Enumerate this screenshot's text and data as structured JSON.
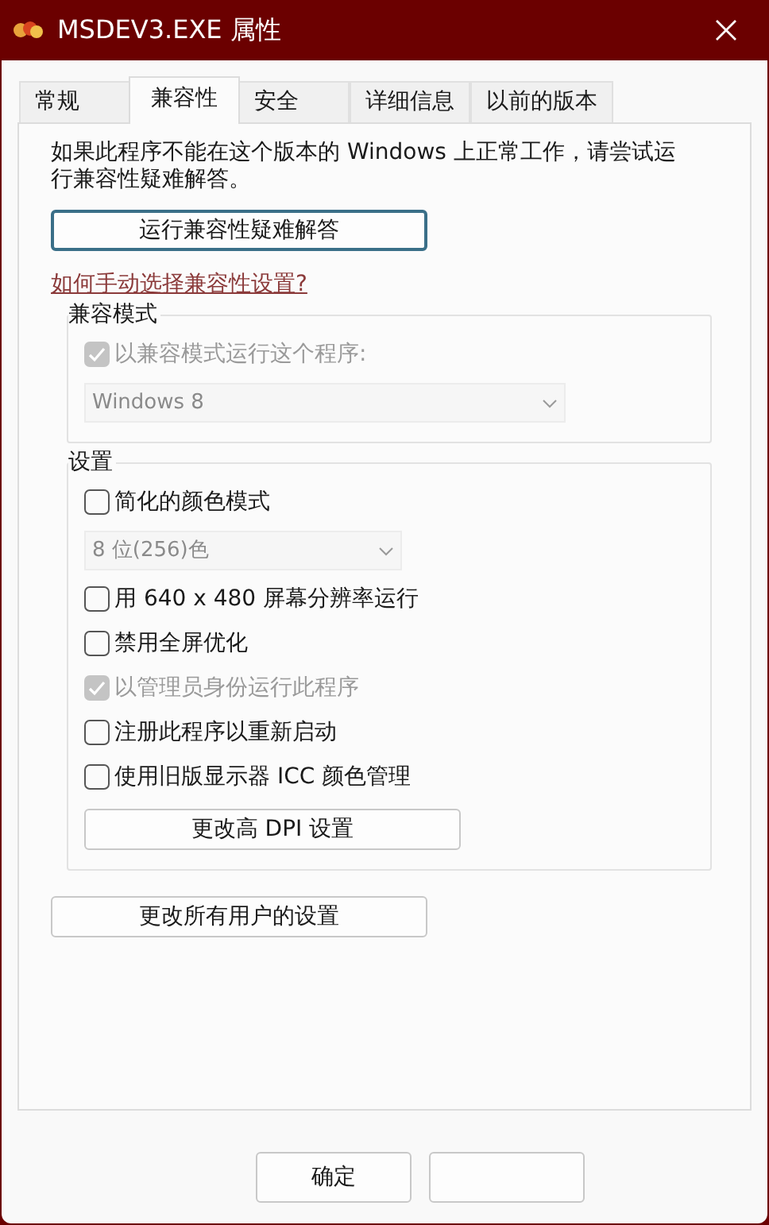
{
  "window": {
    "title": "MSDEV3.EXE 属性"
  },
  "tabs": [
    {
      "label": "常规",
      "selected": false
    },
    {
      "label": "兼容性",
      "selected": true
    },
    {
      "label": "安全",
      "selected": false
    },
    {
      "label": "详细信息",
      "selected": false
    },
    {
      "label": "以前的版本",
      "selected": false
    }
  ],
  "intro": "如果此程序不能在这个版本的 Windows 上正常工作，请尝试运行兼容性疑难解答。",
  "troubleshoot_button": "运行兼容性疑难解答",
  "help_link": "如何手动选择兼容性设置?",
  "compat_mode": {
    "title": "兼容模式",
    "items": [
      {
        "kind": "checkbox",
        "label": "以兼容模式运行这个程序:",
        "checked": true,
        "disabled": true
      },
      {
        "kind": "dropdown",
        "value": "Windows 8",
        "disabled": true
      }
    ]
  },
  "settings": {
    "title": "设置",
    "items": [
      {
        "kind": "checkbox",
        "label": "简化的颜色模式",
        "checked": false,
        "disabled": false
      },
      {
        "kind": "dropdown",
        "value": "8 位(256)色",
        "disabled": true
      },
      {
        "kind": "checkbox",
        "label": "用 640 x 480 屏幕分辨率运行",
        "checked": false,
        "disabled": false
      },
      {
        "kind": "checkbox",
        "label": "禁用全屏优化",
        "checked": false,
        "disabled": false
      },
      {
        "kind": "checkbox",
        "label": "以管理员身份运行此程序",
        "checked": true,
        "disabled": true
      },
      {
        "kind": "checkbox",
        "label": "注册此程序以重新启动",
        "checked": false,
        "disabled": false
      },
      {
        "kind": "checkbox",
        "label": "使用旧版显示器 ICC 颜色管理",
        "checked": false,
        "disabled": false
      },
      {
        "kind": "button",
        "label": "更改高 DPI 设置"
      }
    ]
  },
  "all_users_button": "更改所有用户的设置",
  "footer_buttons": [
    {
      "kind": "labeled",
      "label": "确定"
    },
    {
      "kind": "blank"
    }
  ]
}
